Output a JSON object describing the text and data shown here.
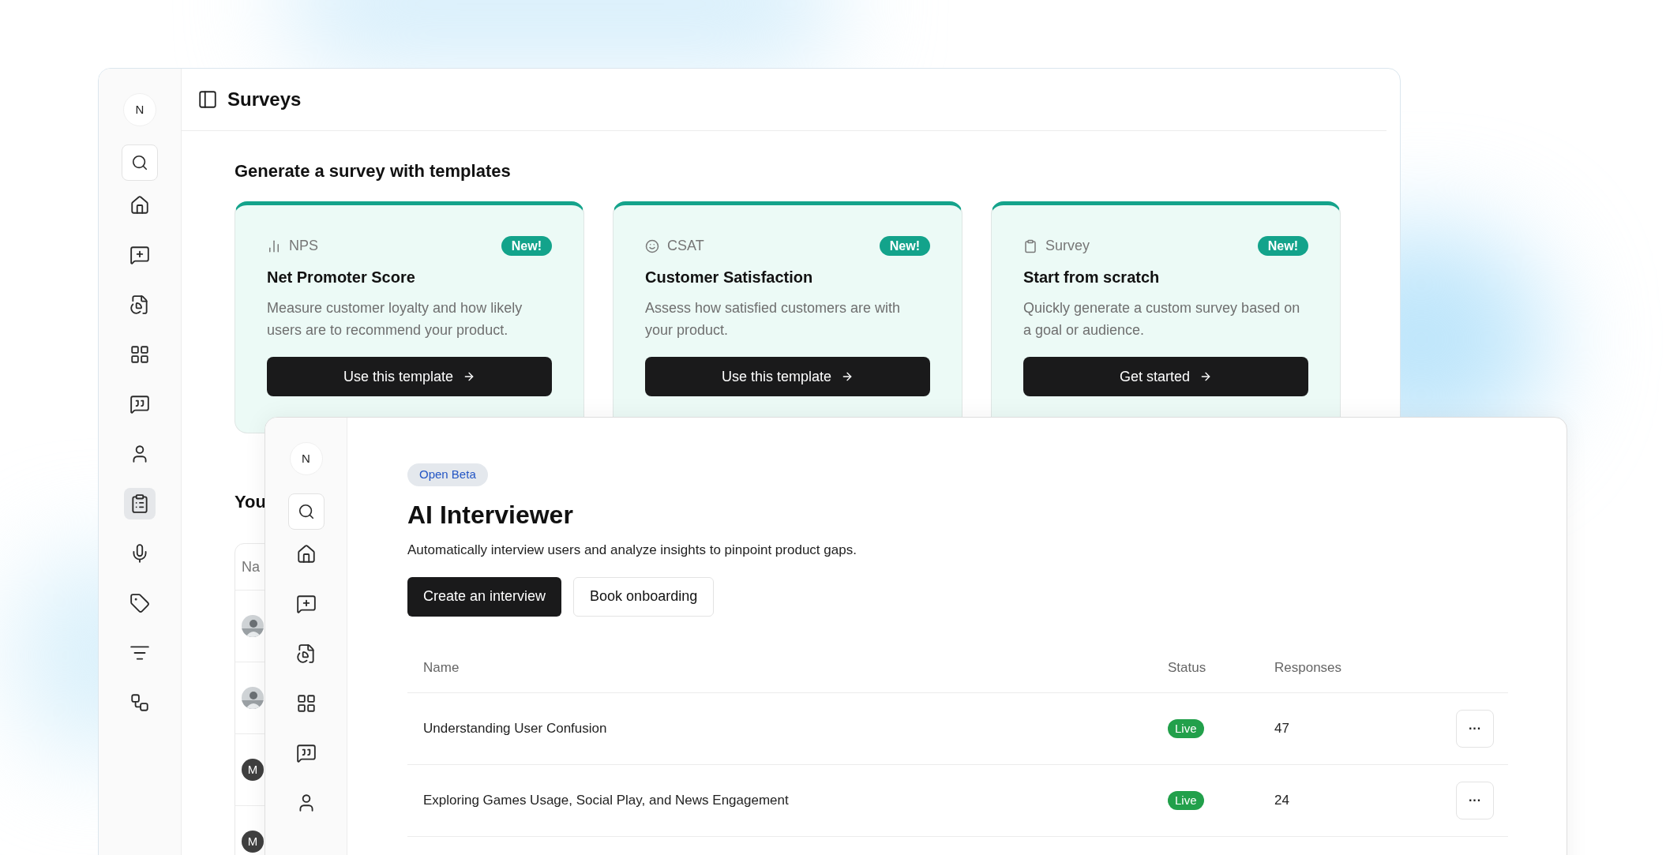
{
  "back_window": {
    "sidebar": {
      "avatar": "N",
      "items": [
        {
          "selected": false
        },
        {
          "selected": false
        },
        {
          "selected": false
        },
        {
          "selected": false
        },
        {
          "selected": false
        },
        {
          "selected": false
        },
        {
          "selected": true
        },
        {
          "selected": false
        },
        {
          "selected": false
        },
        {
          "selected": false
        },
        {
          "selected": false
        }
      ]
    },
    "title": "Surveys",
    "heading": "Generate a survey with templates",
    "cards": [
      {
        "category": "NPS",
        "badge": "New!",
        "title": "Net Promoter Score",
        "description": "Measure customer loyalty and how likely users are to recommend your product.",
        "button": "Use this template"
      },
      {
        "category": "CSAT",
        "badge": "New!",
        "title": "Customer Satisfaction",
        "description": "Assess how satisfied customers are with your product.",
        "button": "Use this template"
      },
      {
        "category": "Survey",
        "badge": "New!",
        "title": "Start from scratch",
        "description": "Quickly generate a custom survey based on a goal or audience.",
        "button": "Get started"
      }
    ],
    "section_heading": "You",
    "table": {
      "column_1": "Na",
      "rows": [
        {
          "kind": "picture"
        },
        {
          "kind": "picture"
        },
        {
          "kind": "initial",
          "avatar": "M"
        },
        {
          "kind": "initial",
          "avatar": "M"
        }
      ]
    }
  },
  "front_window": {
    "sidebar": {
      "avatar": "N",
      "items": [
        {
          "selected": false
        },
        {
          "selected": false
        },
        {
          "selected": false
        },
        {
          "selected": false
        },
        {
          "selected": false
        },
        {
          "selected": false
        }
      ]
    },
    "badge": "Open Beta",
    "title": "AI Interviewer",
    "description": "Automatically interview users and analyze insights to pinpoint product gaps.",
    "buttons": [
      {
        "label": "Create an interview",
        "kind": "primary"
      },
      {
        "label": "Book onboarding",
        "kind": "secondary"
      }
    ],
    "table": {
      "columns": [
        "Name",
        "Status",
        "Responses"
      ],
      "rows": [
        {
          "name": "Understanding User Confusion",
          "status": "Live",
          "responses": "47",
          "action": "···"
        },
        {
          "name": "Exploring Games Usage, Social Play, and News Engagement",
          "status": "Live",
          "responses": "24",
          "action": "···"
        }
      ]
    }
  }
}
